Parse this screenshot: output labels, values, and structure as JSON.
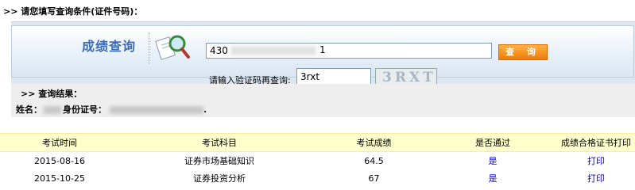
{
  "prompt": ">> 请您填写查询条件(证件号码)：",
  "query": {
    "title": "成绩查询",
    "id_value": "430",
    "id_tail": "1",
    "button_label": "查 询",
    "captcha_label": "请输入验证码再查询:",
    "captcha_value": "3rxt",
    "captcha_image_text": "3RXT"
  },
  "result": {
    "heading": ">> 查询结果：",
    "name_label": "姓名：",
    "id_label": "身份证号：",
    "id_tail": "."
  },
  "table": {
    "headers": [
      "考试时间",
      "考试科目",
      "考试成绩",
      "是否通过",
      "成绩合格证书打印"
    ],
    "rows": [
      {
        "date": "2015-08-16",
        "subject": "证券市场基础知识",
        "score": "64.5",
        "passed": "是",
        "print": "打印"
      },
      {
        "date": "2015-10-25",
        "subject": "证券投资分析",
        "score": "67",
        "passed": "是",
        "print": "打印"
      }
    ]
  },
  "colors": {
    "header_row": "#ffffcc",
    "button": "#f07a05",
    "title": "#3b6cb4",
    "link": "#0000cc"
  }
}
